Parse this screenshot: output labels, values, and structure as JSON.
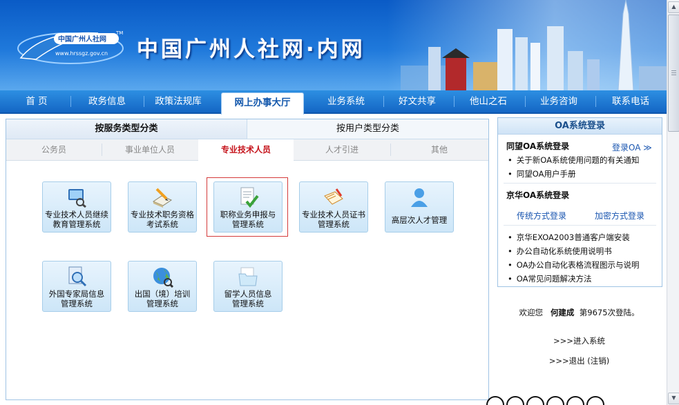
{
  "header": {
    "logo_text": "中国广州人社网",
    "logo_url": "www.hrssgz.gov.cn",
    "logo_tm": "TM",
    "site_title": "中国广州人社网·内网"
  },
  "nav": {
    "items": [
      {
        "label": "首 页"
      },
      {
        "label": "政务信息"
      },
      {
        "label": "政策法规库"
      },
      {
        "label": "网上办事大厅",
        "active": true
      },
      {
        "label": "业务系统"
      },
      {
        "label": "好文共享"
      },
      {
        "label": "他山之石"
      },
      {
        "label": "业务咨询"
      },
      {
        "label": "联系电话"
      }
    ]
  },
  "category_tabs": [
    {
      "label": "按服务类型分类",
      "active": true
    },
    {
      "label": "按用户类型分类",
      "active": false
    }
  ],
  "sub_tabs": [
    {
      "label": "公务员"
    },
    {
      "label": "事业单位人员"
    },
    {
      "label": "专业技术人员",
      "active": true
    },
    {
      "label": "人才引进"
    },
    {
      "label": "其他"
    }
  ],
  "tiles": [
    {
      "line1": "专业技术人员继续",
      "line2": "教育管理系统",
      "icon": "monitor-search-icon"
    },
    {
      "line1": "专业技术职务资格",
      "line2": "考试系统",
      "icon": "book-pencil-icon"
    },
    {
      "line1": "职称业务申报与",
      "line2": "管理系统",
      "icon": "document-check-icon",
      "selected": true
    },
    {
      "line1": "专业技术人员证书",
      "line2": "管理系统",
      "icon": "certificate-pencil-icon"
    },
    {
      "line1": "高层次人才管理",
      "line2": "",
      "icon": "user-icon"
    },
    {
      "line1": "外国专家局信息",
      "line2": "管理系统",
      "icon": "document-magnifier-icon"
    },
    {
      "line1": "出国（境）培训",
      "line2": "管理系统",
      "icon": "globe-icon"
    },
    {
      "line1": "留学人员信息",
      "line2": "管理系统",
      "icon": "folder-icon"
    }
  ],
  "oa": {
    "title": "OA系统登录",
    "tongwang_title": "同望OA系统登录",
    "tongwang_login": "登录OA ≫",
    "tongwang_links": [
      "关于新OA系统使用问题的有关通知",
      "同望OA用户手册"
    ],
    "jinghua_title": "京华OA系统登录",
    "jinghua_login_traditional": "传统方式登录",
    "jinghua_login_encrypted": "加密方式登录",
    "jinghua_links": [
      "京华EXOA2003普通客户端安装",
      "办公自动化系统使用说明书",
      "OA办公自动化表格流程图示与说明",
      "OA常见问题解决方法"
    ]
  },
  "welcome": {
    "prefix": "欢迎您",
    "user": "何建成",
    "suffix": "第9675次登陆。"
  },
  "system_links": {
    "enter": ">>>进入系统",
    "exit": ">>>退出 (注销)"
  },
  "colors": {
    "banner": "#1f79db",
    "nav": "#1466c4",
    "active_sub_tab": "#c5131b",
    "link": "#1a56b0"
  }
}
